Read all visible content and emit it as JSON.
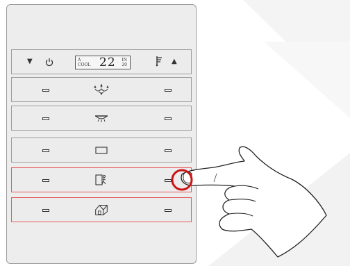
{
  "display": {
    "mode_line1": "A",
    "mode_line2": "COOL",
    "temperature": "22",
    "set_line1": "IN",
    "set_line2": "20"
  },
  "icons": {
    "status_row": [
      "arrow-down-icon",
      "power-icon",
      "fan-speed-icon",
      "arrow-up-icon"
    ],
    "rows": [
      "chandelier-icon",
      "ceiling-lamp-icon",
      "rectangle-icon",
      "door-exit-icon",
      "house-icon"
    ]
  },
  "state": {
    "selected_rows": [
      4,
      5
    ],
    "pressed_button": "row-4-right-led"
  },
  "colors": {
    "selected_border": "#e45a5a",
    "press_ring": "#d11a1a",
    "panel": "#ededed"
  }
}
